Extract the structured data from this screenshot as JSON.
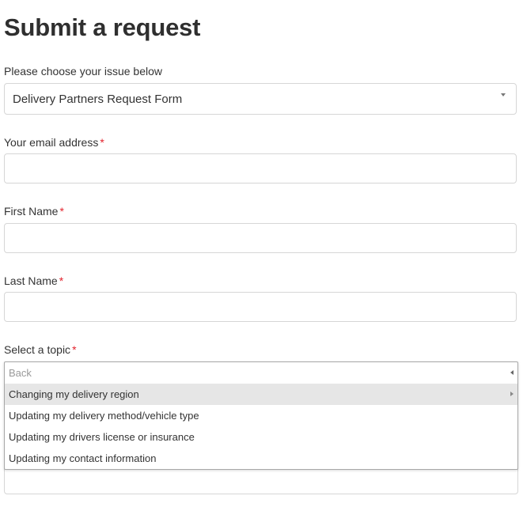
{
  "page": {
    "title": "Submit a request"
  },
  "form": {
    "issue": {
      "label": "Please choose your issue below",
      "selected": "Delivery Partners Request Form"
    },
    "email": {
      "label": "Your email address",
      "required_mark": "*",
      "value": ""
    },
    "first_name": {
      "label": "First Name",
      "required_mark": "*",
      "value": ""
    },
    "last_name": {
      "label": "Last Name",
      "required_mark": "*",
      "value": ""
    },
    "topic": {
      "label": "Select a topic",
      "required_mark": "*",
      "menu": {
        "back_label": "Back",
        "items": [
          {
            "label": "Changing my delivery region",
            "has_submenu": true,
            "highlighted": true
          },
          {
            "label": "Updating my delivery method/vehicle type",
            "has_submenu": false,
            "highlighted": false
          },
          {
            "label": "Updating my drivers license or insurance",
            "has_submenu": false,
            "highlighted": false
          },
          {
            "label": "Updating my contact information",
            "has_submenu": false,
            "highlighted": false
          }
        ]
      }
    }
  },
  "colors": {
    "required": "#e3232d",
    "highlight_row": "#e6e6e6",
    "field_border": "#d6d6d6",
    "text": "#333333"
  },
  "icons": {
    "select_arrow": "chevron-down-icon",
    "back_arrow": "caret-left-icon",
    "submenu_arrow": "caret-right-icon"
  }
}
